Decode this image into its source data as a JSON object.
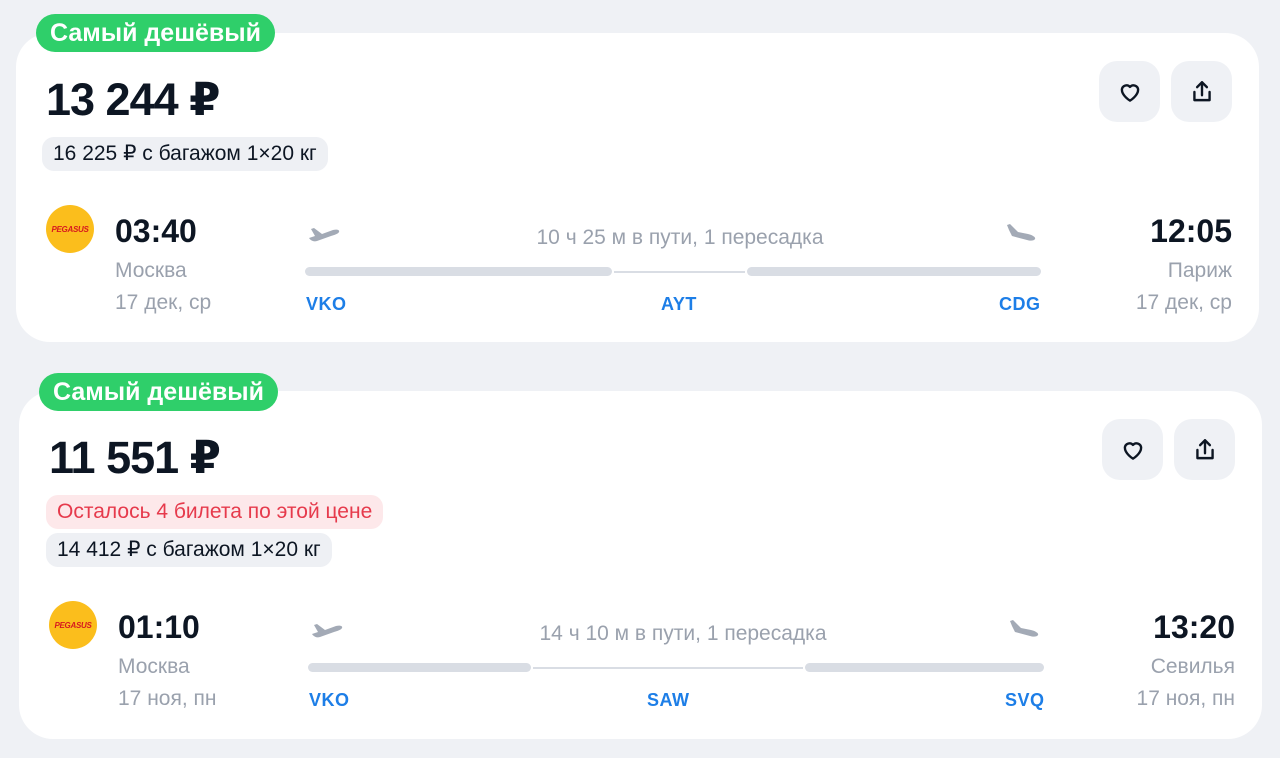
{
  "results": [
    {
      "badge": "Самый дешёвый",
      "price": "13 244 ₽",
      "warning": "",
      "baggage": "16 225 ₽ с багажом 1×20 кг",
      "airline_logo_text": "PEGASUS",
      "departure": {
        "time": "03:40",
        "city": "Москва",
        "date": "17 дек, ср"
      },
      "arrival": {
        "time": "12:05",
        "city": "Париж",
        "date": "17 дек, ср"
      },
      "duration": "10 ч 25 м в пути, 1 пересадка",
      "airports": {
        "from": "VKO",
        "via": "AYT",
        "to": "CDG"
      }
    },
    {
      "badge": "Самый дешёвый",
      "price": "11 551 ₽",
      "warning": "Осталось 4 билета по этой цене",
      "baggage": "14 412 ₽ с багажом 1×20 кг",
      "airline_logo_text": "PEGASUS",
      "departure": {
        "time": "01:10",
        "city": "Москва",
        "date": "17 ноя, пн"
      },
      "arrival": {
        "time": "13:20",
        "city": "Севилья",
        "date": "17 ноя, пн"
      },
      "duration": "14 ч 10 м в пути, 1 пересадка",
      "airports": {
        "from": "VKO",
        "via": "SAW",
        "to": "SVQ"
      }
    }
  ],
  "icons": {
    "favorite": "heart-icon",
    "share": "share-icon",
    "takeoff": "plane-takeoff-icon",
    "landing": "plane-landing-icon"
  },
  "colors": {
    "badge": "#2fcf6a",
    "airport_code": "#1d7ee7",
    "warning": "#e63a4c",
    "logo": "#fbbe1c"
  }
}
